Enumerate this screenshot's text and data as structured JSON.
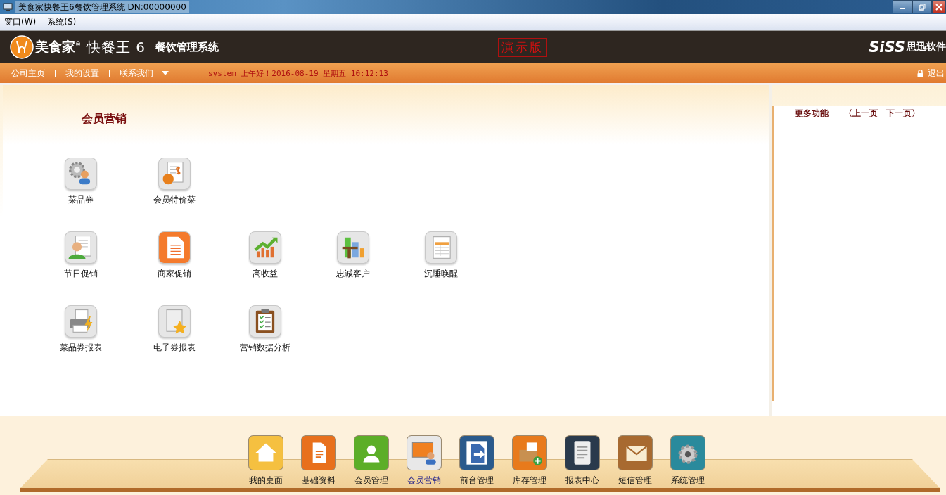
{
  "window": {
    "title": "美食家快餐王6餐饮管理系统 DN:00000000"
  },
  "menu": [
    "窗口(W)",
    "系统(S)"
  ],
  "header": {
    "brand": "美食家",
    "registered": "®",
    "product": "快餐王 6",
    "subtitle": "餐饮管理系统",
    "demo_stamp": "演示版",
    "vendor_logo": "SiSS",
    "vendor_name": "思迅软件"
  },
  "nav": {
    "links": [
      "公司主页",
      "我的设置",
      "联系我们"
    ],
    "greeting": "system 上午好！2016-08-19 星期五 10:12:13",
    "logout": "退出"
  },
  "section_title": "会员营销",
  "function_rows": [
    [
      "菜品券",
      "会员特价菜"
    ],
    [
      "节日促销",
      "商家促销",
      "高收益",
      "忠诚客户",
      "沉睡唤醒"
    ],
    [
      "菜品券报表",
      "电子券报表",
      "营销数据分析"
    ]
  ],
  "side_panel": {
    "title": "更多功能",
    "prev": "〈上一页",
    "next": "下一页〉"
  },
  "dock": [
    {
      "label": "我的桌面",
      "selected": false
    },
    {
      "label": "基础资料",
      "selected": false
    },
    {
      "label": "会员管理",
      "selected": false
    },
    {
      "label": "会员营销",
      "selected": true
    },
    {
      "label": "前台管理",
      "selected": false
    },
    {
      "label": "库存管理",
      "selected": false
    },
    {
      "label": "报表中心",
      "selected": false
    },
    {
      "label": "短信管理",
      "selected": false
    },
    {
      "label": "系统管理",
      "selected": false
    }
  ]
}
